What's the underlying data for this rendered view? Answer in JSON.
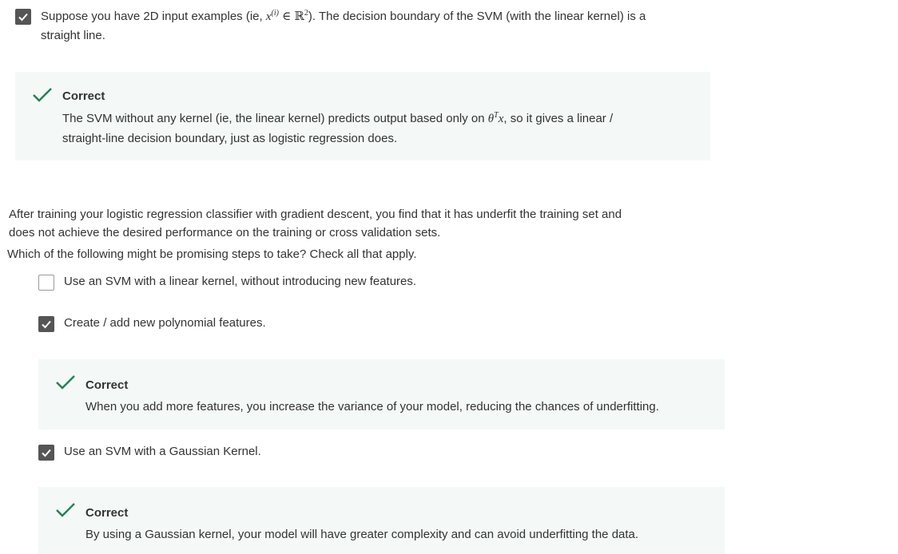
{
  "q1": {
    "option": {
      "checked": true,
      "text_before": "Suppose you have 2D input examples (ie,",
      "math_x": "x",
      "math_sup": "(i)",
      "math_in": "∈",
      "math_R": "ℝ",
      "math_R_sup": "2",
      "text_after": "). The decision boundary of the SVM (with the linear kernel) is a",
      "line2": "straight line."
    },
    "feedback": {
      "status": "Correct",
      "text_before": "The SVM without any kernel (ie, the linear kernel) predicts output based only on",
      "math_theta": "θ",
      "math_T": "T",
      "math_x": "x",
      "text_after": ", so it gives a linear /",
      "line2": "straight-line decision boundary, just as logistic regression does."
    }
  },
  "q2": {
    "prompt_line1": "After training your logistic regression classifier with gradient descent, you find that it has underfit the training set and",
    "prompt_line2": "does not achieve the desired performance on the training or cross validation sets.",
    "instruction": "Which of the following might be promising steps to take? Check all that apply.",
    "options": [
      {
        "label": "Use an SVM with a linear kernel, without introducing new features.",
        "checked": false
      },
      {
        "label": "Create / add new polynomial features.",
        "checked": true,
        "feedback": {
          "status": "Correct",
          "text": "When you add more features, you increase the variance of your model, reducing the chances of underfitting."
        }
      },
      {
        "label": "Use an SVM with a Gaussian Kernel.",
        "checked": true,
        "feedback": {
          "status": "Correct",
          "text": "By using a Gaussian kernel, your model will have greater complexity and can avoid underfitting the data."
        }
      }
    ]
  },
  "colors": {
    "checkbox_checked": "#555555",
    "correct_green": "#1f8354",
    "feedback_bg": "#f4f8f6"
  },
  "icons": {
    "checkbox": "checkmark-icon",
    "correct": "correct-checkmark-icon"
  }
}
